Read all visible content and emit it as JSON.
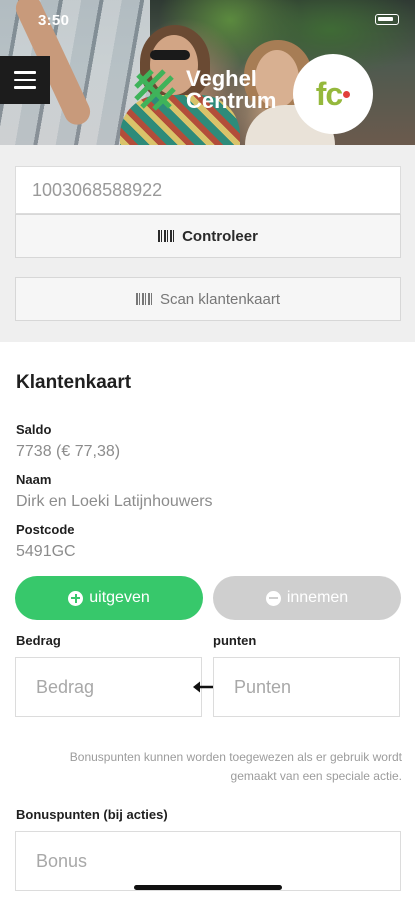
{
  "status_bar": {
    "time": "3:50"
  },
  "header": {
    "brand_line1": "Veghel",
    "brand_line2": "Centrum",
    "partner_logo": "fc",
    "brand_color": "#3fb35a",
    "partner_color": "#95b83c"
  },
  "scan": {
    "card_number_value": "1003068588922",
    "controleer_label": "Controleer",
    "scan_label": "Scan klantenkaart"
  },
  "card": {
    "title": "Klantenkaart",
    "saldo_label": "Saldo",
    "saldo_value": "7738 (€ 77,38)",
    "naam_label": "Naam",
    "naam_value": "Dirk en Loeki Latijnhouwers",
    "postcode_label": "Postcode",
    "postcode_value": "5491GC"
  },
  "actions": {
    "uitgeven_label": "uitgeven",
    "innemen_label": "innemen",
    "active_color": "#37c86b",
    "inactive_color": "#cfcfcf"
  },
  "conversion": {
    "bedrag_label": "Bedrag",
    "bedrag_placeholder": "Bedrag",
    "punten_label": "punten",
    "punten_placeholder": "Punten"
  },
  "bonus": {
    "note": "Bonuspunten kunnen worden toegewezen als er gebruik wordt gemaakt van een speciale actie.",
    "label": "Bonuspunten (bij acties)",
    "placeholder": "Bonus"
  },
  "icons": {
    "menu": "hamburger-icon",
    "barcode": "barcode-icon",
    "plus": "plus-circle-icon",
    "minus": "minus-circle-icon",
    "arrow": "double-arrow-icon"
  }
}
